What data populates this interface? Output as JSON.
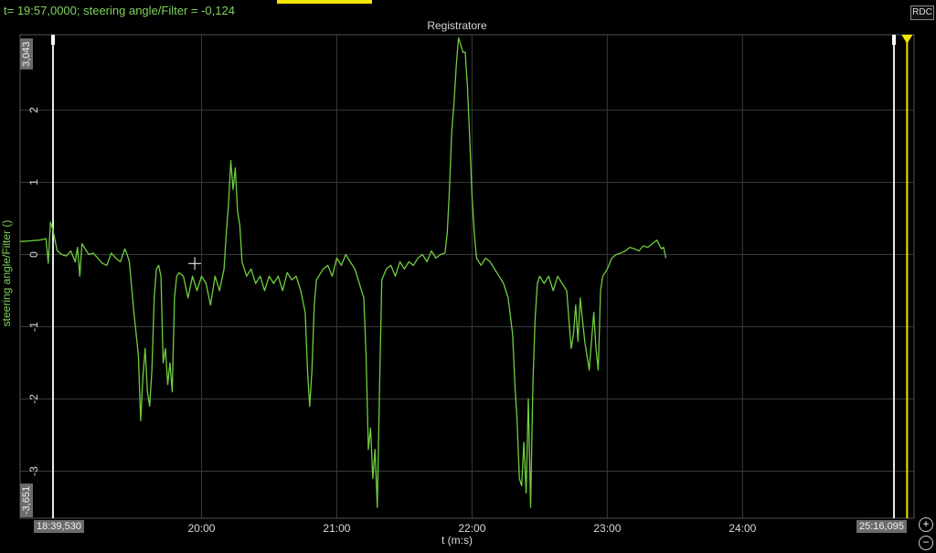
{
  "status": {
    "readout": "t= 19:57,0000; steering angle/Filter = -0,124"
  },
  "toolbar": {
    "rdc_label": "RDC"
  },
  "zoom": {
    "in_label": "+",
    "out_label": "−"
  },
  "colors": {
    "series": "#6fce3f",
    "grid": "#3a3a3a",
    "cursor": "#f3e600",
    "marker": "#e8e8e8"
  },
  "chart_data": {
    "type": "line",
    "title": "Registratore",
    "xlabel": "t (m:s)",
    "ylabel": "steering angle/Filter ()",
    "x_range_labels": {
      "start": "18:39,530",
      "end": "25:16,095"
    },
    "y_range_labels": {
      "max": "3,043",
      "min": "-3,651"
    },
    "xlim": [
      1119.53,
      1516.095
    ],
    "ylim": [
      -3.651,
      3.043
    ],
    "x_ticks": [
      {
        "value": 1200,
        "label": "20:00"
      },
      {
        "value": 1260,
        "label": "21:00"
      },
      {
        "value": 1320,
        "label": "22:00"
      },
      {
        "value": 1380,
        "label": "23:00"
      },
      {
        "value": 1440,
        "label": "24:00"
      }
    ],
    "y_ticks": [
      {
        "value": 2,
        "label": "2"
      },
      {
        "value": 1,
        "label": "1"
      },
      {
        "value": 0,
        "label": "0"
      },
      {
        "value": -1,
        "label": "-1"
      },
      {
        "value": -2,
        "label": "-2"
      },
      {
        "value": -3,
        "label": "-3"
      }
    ],
    "grid": true,
    "cursor_x": 1513.0,
    "crosshair": {
      "x": 1197,
      "y": -0.124
    },
    "series": [
      {
        "points": [
          [
            1119.5,
            0.18
          ],
          [
            1124,
            0.19
          ],
          [
            1128,
            0.2
          ],
          [
            1131,
            0.22
          ],
          [
            1132,
            -0.12
          ],
          [
            1133,
            0.45
          ],
          [
            1134,
            0.35
          ],
          [
            1136,
            0.05
          ],
          [
            1138,
            0.0
          ],
          [
            1140,
            -0.02
          ],
          [
            1142,
            0.05
          ],
          [
            1144,
            -0.1
          ],
          [
            1145,
            0.1
          ],
          [
            1146,
            -0.3
          ],
          [
            1147,
            0.15
          ],
          [
            1148,
            0.1
          ],
          [
            1150,
            0.0
          ],
          [
            1152,
            0.02
          ],
          [
            1154,
            -0.05
          ],
          [
            1156,
            -0.12
          ],
          [
            1158,
            -0.15
          ],
          [
            1160,
            0.02
          ],
          [
            1162,
            -0.05
          ],
          [
            1164,
            -0.1
          ],
          [
            1166,
            0.08
          ],
          [
            1167,
            0.0
          ],
          [
            1168,
            -0.1
          ],
          [
            1170,
            -0.8
          ],
          [
            1172,
            -1.4
          ],
          [
            1173,
            -2.3
          ],
          [
            1174,
            -1.7
          ],
          [
            1175,
            -1.3
          ],
          [
            1176,
            -1.9
          ],
          [
            1177,
            -2.1
          ],
          [
            1178,
            -1.6
          ],
          [
            1179,
            -0.6
          ],
          [
            1180,
            -0.2
          ],
          [
            1181,
            -0.15
          ],
          [
            1182,
            -0.3
          ],
          [
            1183,
            -1.5
          ],
          [
            1184,
            -1.3
          ],
          [
            1185,
            -1.8
          ],
          [
            1186,
            -1.5
          ],
          [
            1187,
            -1.9
          ],
          [
            1188,
            -0.6
          ],
          [
            1189,
            -0.3
          ],
          [
            1190,
            -0.25
          ],
          [
            1192,
            -0.3
          ],
          [
            1194,
            -0.6
          ],
          [
            1196,
            -0.3
          ],
          [
            1198,
            -0.5
          ],
          [
            1200,
            -0.3
          ],
          [
            1202,
            -0.4
          ],
          [
            1204,
            -0.7
          ],
          [
            1206,
            -0.3
          ],
          [
            1208,
            -0.5
          ],
          [
            1210,
            -0.2
          ],
          [
            1211,
            0.3
          ],
          [
            1212,
            0.7
          ],
          [
            1213,
            1.3
          ],
          [
            1214,
            0.9
          ],
          [
            1215,
            1.2
          ],
          [
            1216,
            0.6
          ],
          [
            1217,
            0.4
          ],
          [
            1218,
            -0.1
          ],
          [
            1220,
            -0.3
          ],
          [
            1222,
            -0.2
          ],
          [
            1224,
            -0.4
          ],
          [
            1226,
            -0.3
          ],
          [
            1228,
            -0.5
          ],
          [
            1230,
            -0.3
          ],
          [
            1232,
            -0.4
          ],
          [
            1234,
            -0.3
          ],
          [
            1236,
            -0.5
          ],
          [
            1238,
            -0.25
          ],
          [
            1240,
            -0.35
          ],
          [
            1242,
            -0.3
          ],
          [
            1244,
            -0.5
          ],
          [
            1246,
            -0.8
          ],
          [
            1247,
            -1.6
          ],
          [
            1248,
            -2.1
          ],
          [
            1249,
            -1.6
          ],
          [
            1250,
            -0.7
          ],
          [
            1251,
            -0.35
          ],
          [
            1252,
            -0.3
          ],
          [
            1254,
            -0.2
          ],
          [
            1256,
            -0.15
          ],
          [
            1258,
            -0.3
          ],
          [
            1260,
            -0.05
          ],
          [
            1262,
            -0.15
          ],
          [
            1264,
            0.0
          ],
          [
            1266,
            -0.1
          ],
          [
            1268,
            -0.2
          ],
          [
            1270,
            -0.4
          ],
          [
            1272,
            -0.6
          ],
          [
            1273,
            -1.4
          ],
          [
            1274,
            -2.7
          ],
          [
            1275,
            -2.4
          ],
          [
            1276,
            -3.1
          ],
          [
            1277,
            -2.7
          ],
          [
            1278,
            -3.5
          ],
          [
            1279,
            -1.8
          ],
          [
            1280,
            -0.35
          ],
          [
            1282,
            -0.2
          ],
          [
            1284,
            -0.15
          ],
          [
            1286,
            -0.3
          ],
          [
            1288,
            -0.1
          ],
          [
            1290,
            -0.2
          ],
          [
            1292,
            -0.1
          ],
          [
            1294,
            -0.15
          ],
          [
            1296,
            -0.05
          ],
          [
            1298,
            0.0
          ],
          [
            1300,
            -0.1
          ],
          [
            1302,
            0.05
          ],
          [
            1304,
            -0.05
          ],
          [
            1306,
            0.0
          ],
          [
            1308,
            0.02
          ],
          [
            1309,
            0.3
          ],
          [
            1310,
            0.9
          ],
          [
            1311,
            1.7
          ],
          [
            1312,
            2.1
          ],
          [
            1313,
            2.6
          ],
          [
            1314,
            3.0
          ],
          [
            1315,
            2.9
          ],
          [
            1316,
            2.8
          ],
          [
            1317,
            2.8
          ],
          [
            1318,
            2.3
          ],
          [
            1319,
            1.6
          ],
          [
            1320,
            0.8
          ],
          [
            1321,
            0.3
          ],
          [
            1322,
            -0.05
          ],
          [
            1324,
            -0.15
          ],
          [
            1326,
            -0.05
          ],
          [
            1328,
            -0.1
          ],
          [
            1330,
            -0.2
          ],
          [
            1332,
            -0.3
          ],
          [
            1334,
            -0.4
          ],
          [
            1336,
            -0.6
          ],
          [
            1338,
            -1.1
          ],
          [
            1339,
            -1.8
          ],
          [
            1340,
            -2.3
          ],
          [
            1341,
            -3.1
          ],
          [
            1342,
            -3.2
          ],
          [
            1343,
            -2.6
          ],
          [
            1344,
            -3.3
          ],
          [
            1345,
            -2.0
          ],
          [
            1346,
            -3.5
          ],
          [
            1347,
            -1.8
          ],
          [
            1348,
            -0.9
          ],
          [
            1349,
            -0.4
          ],
          [
            1350,
            -0.3
          ],
          [
            1352,
            -0.4
          ],
          [
            1354,
            -0.3
          ],
          [
            1356,
            -0.5
          ],
          [
            1358,
            -0.3
          ],
          [
            1360,
            -0.4
          ],
          [
            1362,
            -0.5
          ],
          [
            1363,
            -0.9
          ],
          [
            1364,
            -1.3
          ],
          [
            1365,
            -1.1
          ],
          [
            1366,
            -0.7
          ],
          [
            1367,
            -1.2
          ],
          [
            1368,
            -0.6
          ],
          [
            1369,
            -0.9
          ],
          [
            1370,
            -1.2
          ],
          [
            1371,
            -1.4
          ],
          [
            1372,
            -1.6
          ],
          [
            1374,
            -0.8
          ],
          [
            1375,
            -1.3
          ],
          [
            1376,
            -1.6
          ],
          [
            1377,
            -0.5
          ],
          [
            1378,
            -0.3
          ],
          [
            1380,
            -0.2
          ],
          [
            1382,
            -0.05
          ],
          [
            1384,
            0.0
          ],
          [
            1386,
            0.02
          ],
          [
            1388,
            0.05
          ],
          [
            1390,
            0.1
          ],
          [
            1392,
            0.08
          ],
          [
            1394,
            0.05
          ],
          [
            1396,
            0.12
          ],
          [
            1398,
            0.1
          ],
          [
            1400,
            0.15
          ],
          [
            1402,
            0.2
          ],
          [
            1404,
            0.08
          ],
          [
            1405,
            0.1
          ],
          [
            1406,
            -0.05
          ]
        ]
      }
    ]
  }
}
